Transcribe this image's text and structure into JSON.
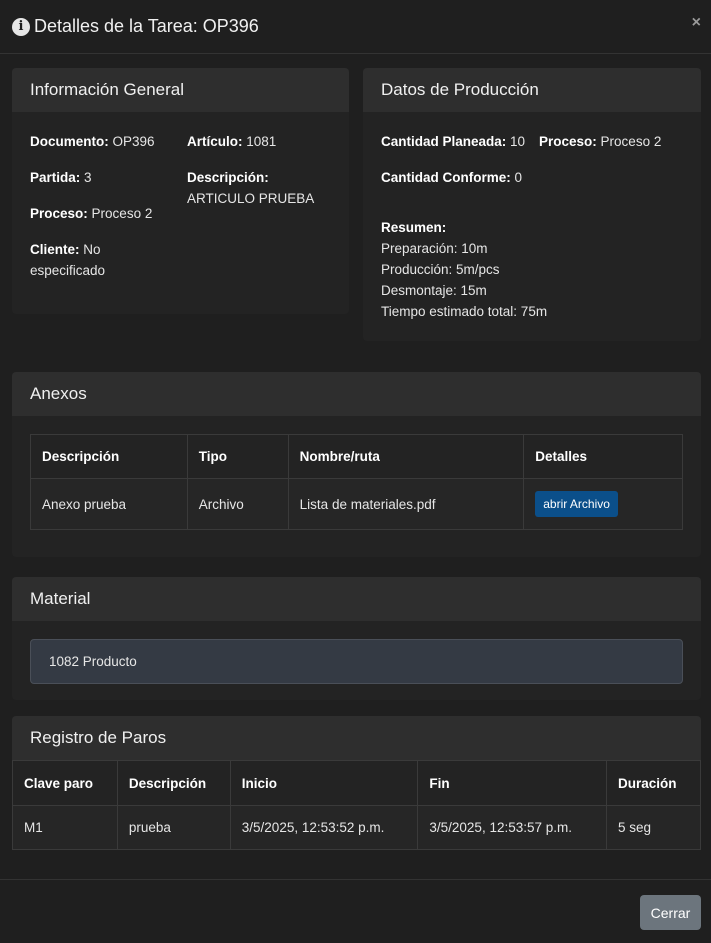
{
  "header": {
    "title": "Detalles de la Tarea: OP396",
    "close_symbol": "×"
  },
  "general": {
    "title": "Información General",
    "documento": {
      "label": "Documento:",
      "value": "OP396"
    },
    "articulo": {
      "label": "Artículo:",
      "value": "1081"
    },
    "partida": {
      "label": "Partida:",
      "value": "3"
    },
    "descripcion": {
      "label": "Descripción:",
      "value": "ARTICULO PRUEBA"
    },
    "proceso": {
      "label": "Proceso:",
      "value": "Proceso 2"
    },
    "cliente": {
      "label": "Cliente:",
      "value": "No especificado"
    }
  },
  "produccion": {
    "title": "Datos de Producción",
    "cantidad_planeada": {
      "label": "Cantidad Planeada:",
      "value": "10"
    },
    "proceso": {
      "label": "Proceso:",
      "value": "Proceso 2"
    },
    "cantidad_conforme": {
      "label": "Cantidad Conforme:",
      "value": "0"
    },
    "resumen": {
      "label": "Resumen:",
      "preparacion": "Preparación: 10m",
      "produccion": "Producción: 5m/pcs",
      "desmontaje": "Desmontaje: 15m",
      "total": "Tiempo estimado total: 75m"
    }
  },
  "anexos": {
    "title": "Anexos",
    "columns": [
      "Descripción",
      "Tipo",
      "Nombre/ruta",
      "Detalles"
    ],
    "rows": [
      {
        "descripcion": "Anexo prueba",
        "tipo": "Archivo",
        "nombre": "Lista de materiales.pdf",
        "button": "abrir Archivo"
      }
    ]
  },
  "material": {
    "title": "Material",
    "value": "1082 Producto"
  },
  "paros": {
    "title": "Registro de Paros",
    "columns": [
      "Clave paro",
      "Descripción",
      "Inicio",
      "Fin",
      "Duración"
    ],
    "rows": [
      {
        "clave": "M1",
        "descripcion": "prueba",
        "inicio": "3/5/2025, 12:53:52 p.m.",
        "fin": "3/5/2025, 12:53:57 p.m.",
        "duracion": "5 seg"
      }
    ]
  },
  "footer": {
    "close_label": "Cerrar"
  }
}
